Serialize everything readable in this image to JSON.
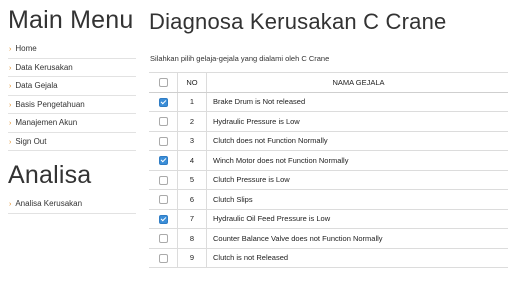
{
  "sidebar": {
    "menu_title": "Main Menu",
    "menu_items": [
      {
        "label": "Home"
      },
      {
        "label": "Data Kerusakan"
      },
      {
        "label": "Data Gejala"
      },
      {
        "label": "Basis Pengetahuan"
      },
      {
        "label": "Manajemen Akun"
      },
      {
        "label": "Sign Out"
      }
    ],
    "analisa_title": "Analisa",
    "analisa_items": [
      {
        "label": "Analisa Kerusakan"
      }
    ],
    "arrow_glyph": "›"
  },
  "main": {
    "title": "Diagnosa Kerusakan C Crane",
    "instruction": "Silahkan pilih gelaja-gejala yang dialami oleh C Crane",
    "table": {
      "headers": {
        "checkbox": "",
        "no": "NO",
        "name": "NAMA GEJALA"
      },
      "rows": [
        {
          "no": "1",
          "name": "Brake Drum is Not released",
          "checked": true
        },
        {
          "no": "2",
          "name": "Hydraulic Pressure is Low",
          "checked": false
        },
        {
          "no": "3",
          "name": "Clutch does not Function Normally",
          "checked": false
        },
        {
          "no": "4",
          "name": "Winch Motor does not Function Normally",
          "checked": true
        },
        {
          "no": "5",
          "name": "Clutch Pressure is Low",
          "checked": false
        },
        {
          "no": "6",
          "name": "Clutch Slips",
          "checked": false
        },
        {
          "no": "7",
          "name": "Hydraulic Oil Feed Pressure is Low",
          "checked": true
        },
        {
          "no": "8",
          "name": "Counter Balance Valve does not Function Normally",
          "checked": false
        },
        {
          "no": "9",
          "name": "Clutch is not Released",
          "checked": false
        }
      ]
    }
  },
  "colors": {
    "accent_arrow": "#e08a1e",
    "checkbox_checked": "#3b8ed8"
  }
}
